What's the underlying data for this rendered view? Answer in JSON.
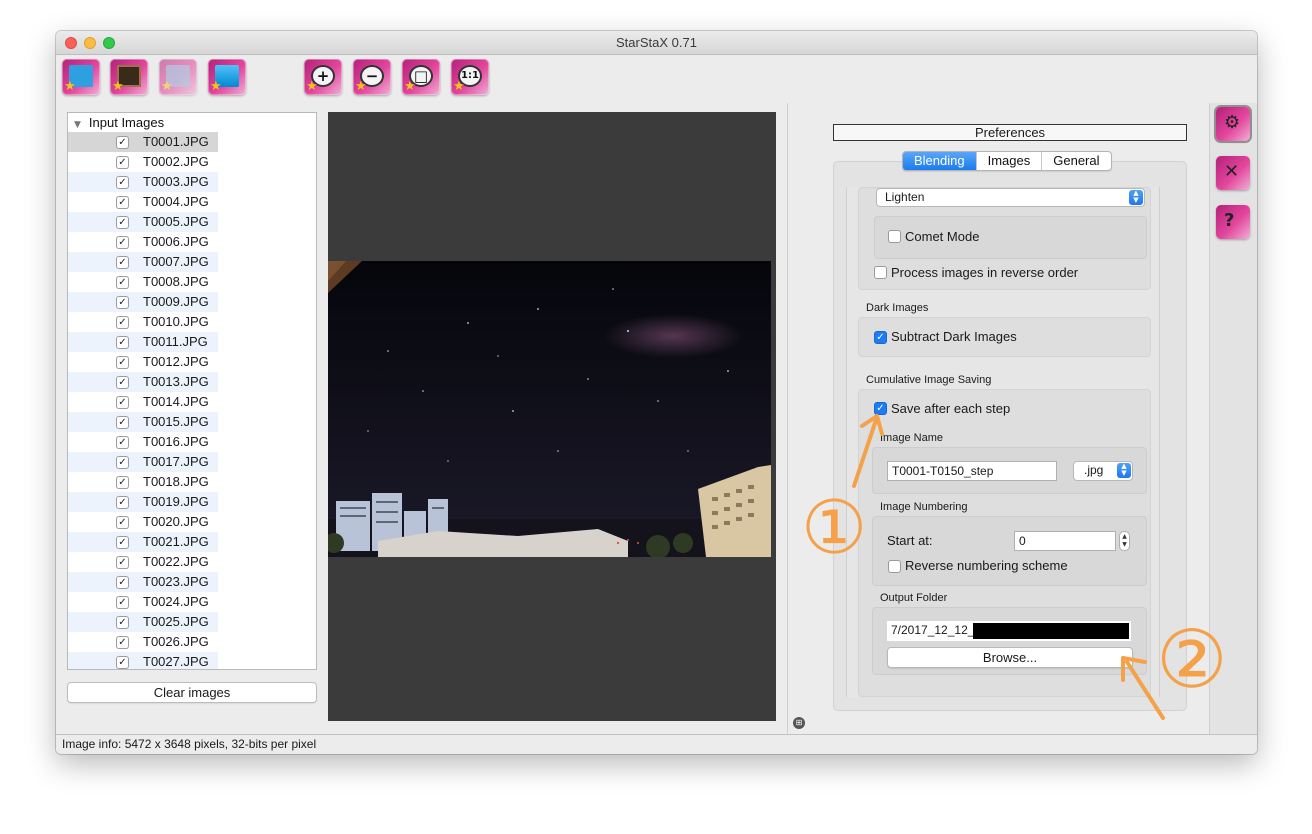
{
  "window": {
    "title": "StarStaX 0.71"
  },
  "toolbar": {
    "buttons": [
      {
        "name": "open-images-icon"
      },
      {
        "name": "open-dark-images-icon"
      },
      {
        "name": "save-image-icon"
      },
      {
        "name": "start-blending-icon"
      },
      {
        "name": "zoom-in-icon"
      },
      {
        "name": "zoom-out-icon"
      },
      {
        "name": "fit-to-window-icon"
      },
      {
        "name": "actual-size-icon",
        "label": "1:1"
      }
    ]
  },
  "input_images": {
    "header": "Input Images",
    "files": [
      "T0001.JPG",
      "T0002.JPG",
      "T0003.JPG",
      "T0004.JPG",
      "T0005.JPG",
      "T0006.JPG",
      "T0007.JPG",
      "T0008.JPG",
      "T0009.JPG",
      "T0010.JPG",
      "T0011.JPG",
      "T0012.JPG",
      "T0013.JPG",
      "T0014.JPG",
      "T0015.JPG",
      "T0016.JPG",
      "T0017.JPG",
      "T0018.JPG",
      "T0019.JPG",
      "T0020.JPG",
      "T0021.JPG",
      "T0022.JPG",
      "T0023.JPG",
      "T0024.JPG",
      "T0025.JPG",
      "T0026.JPG",
      "T0027.JPG"
    ],
    "selected_index": 0,
    "all_checked": true,
    "clear_button": "Clear images"
  },
  "preferences": {
    "title": "Preferences",
    "tabs": [
      "Blending",
      "Images",
      "General"
    ],
    "active_tab": "Blending",
    "blend_mode": "Lighten",
    "comet_mode": {
      "label": "Comet Mode",
      "checked": false
    },
    "reverse_order": {
      "label": "Process images in reverse order",
      "checked": false
    },
    "dark_images": {
      "heading": "Dark Images",
      "subtract": {
        "label": "Subtract Dark Images",
        "checked": true
      }
    },
    "cumulative_saving": {
      "heading": "Cumulative Image Saving",
      "save_each_step": {
        "label": "Save after each step",
        "checked": true
      },
      "image_name": {
        "heading": "Image Name",
        "value": "T0001-T0150_step",
        "extension": ".jpg"
      },
      "numbering": {
        "heading": "Image Numbering",
        "start_label": "Start at:",
        "start_value": "0",
        "reverse": {
          "label": "Reverse numbering scheme",
          "checked": false
        }
      },
      "output_folder": {
        "heading": "Output Folder",
        "path": "7/2017_12_12_",
        "browse": "Browse..."
      }
    }
  },
  "side_tabs": [
    "blending-settings-icon",
    "image-tools-icon",
    "help-icon"
  ],
  "status": {
    "text": "Image info: 5472 x 3648 pixels, 32-bits per pixel"
  },
  "annotations": {
    "one": "①",
    "two": "②"
  },
  "colors": {
    "accent": "#1e7cf2",
    "annotation": "#f4a14a",
    "preview_bg": "#3b3b3b"
  }
}
